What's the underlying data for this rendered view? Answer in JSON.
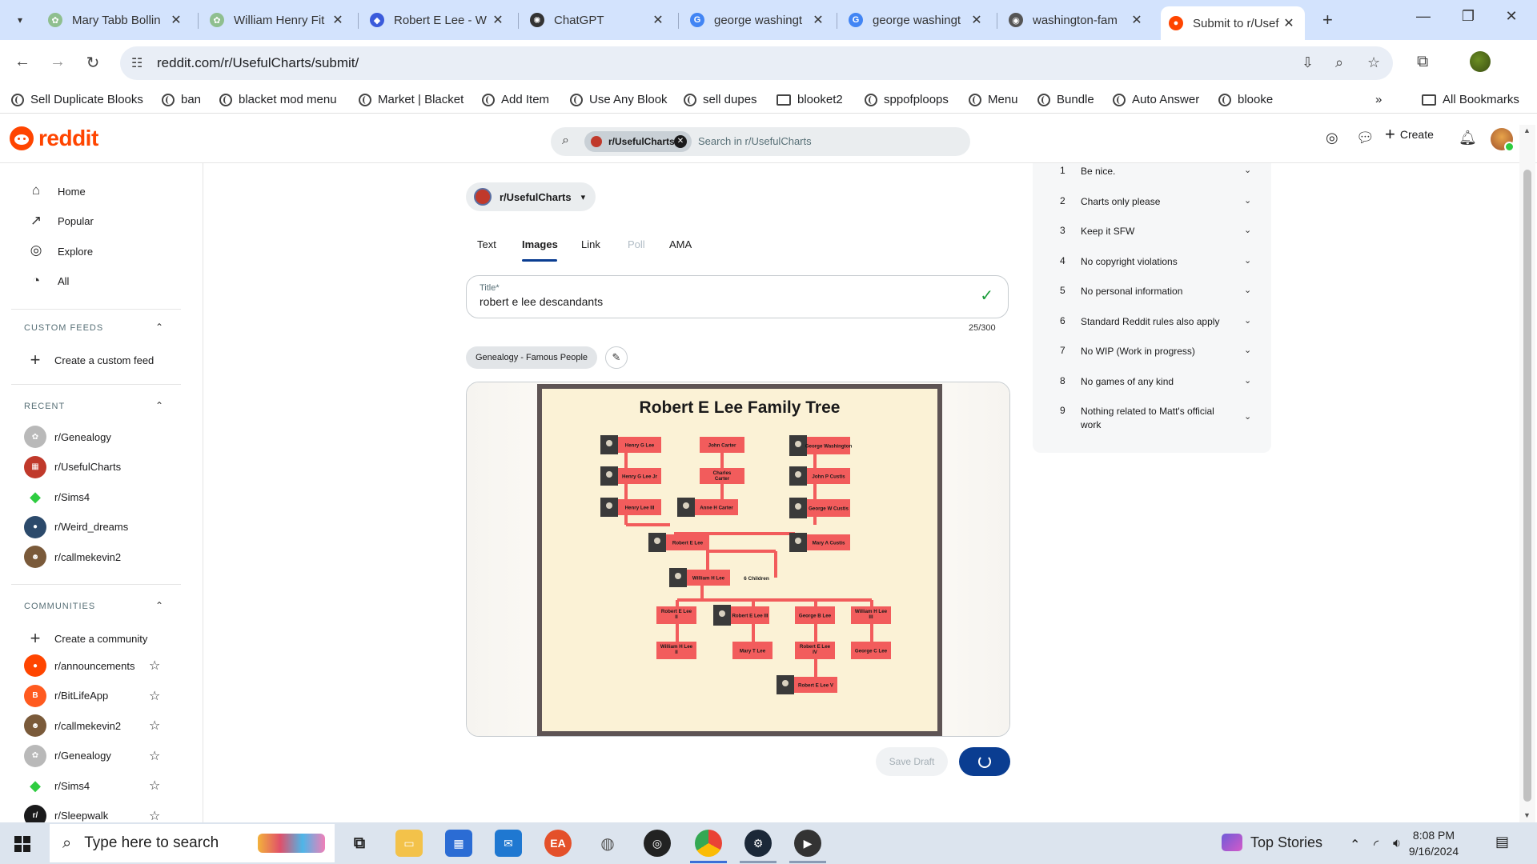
{
  "browser": {
    "tabs": [
      {
        "title": "Mary Tabb Bollin",
        "fav_color": "#8fbf8f",
        "fav": "✿"
      },
      {
        "title": "William Henry Fit",
        "fav_color": "#8fbf8f",
        "fav": "✿"
      },
      {
        "title": "Robert E Lee - W",
        "fav_color": "#3b5bdb",
        "fav": "◆"
      },
      {
        "title": "ChatGPT",
        "fav_color": "#333333",
        "fav": "✺"
      },
      {
        "title": "george washingt",
        "fav_color": "#4285f4",
        "fav": "G"
      },
      {
        "title": "george washingt",
        "fav_color": "#4285f4",
        "fav": "G"
      },
      {
        "title": "washington-fam",
        "fav_color": "#555555",
        "fav": "◉"
      },
      {
        "title": "Submit to r/Usef",
        "fav_color": "#ff4500",
        "fav": "●"
      }
    ],
    "url": "reddit.com/r/UsefulCharts/submit/",
    "bookmarks": [
      {
        "label": "Sell Duplicate Blooks",
        "type": "globe"
      },
      {
        "label": "ban",
        "type": "globe"
      },
      {
        "label": "blacket mod menu",
        "type": "globe"
      },
      {
        "label": "Market | Blacket",
        "type": "globe"
      },
      {
        "label": "Add Item",
        "type": "globe"
      },
      {
        "label": "Use Any Blook",
        "type": "globe"
      },
      {
        "label": "sell dupes",
        "type": "globe"
      },
      {
        "label": "blooket2",
        "type": "folder"
      },
      {
        "label": "sppofploops",
        "type": "globe"
      },
      {
        "label": "Menu",
        "type": "globe"
      },
      {
        "label": "Bundle",
        "type": "globe"
      },
      {
        "label": "Auto Answer",
        "type": "globe"
      },
      {
        "label": "blooke",
        "type": "globe"
      }
    ],
    "all_bookmarks": "All Bookmarks"
  },
  "header": {
    "logo": "reddit",
    "search_chip": "r/UsefulCharts",
    "search_placeholder": "Search in r/UsefulCharts",
    "create": "Create"
  },
  "sidebar": {
    "nav": [
      {
        "label": "Home",
        "icon": "⌂"
      },
      {
        "label": "Popular",
        "icon": "↗"
      },
      {
        "label": "Explore",
        "icon": "◎"
      },
      {
        "label": "All",
        "icon": "◔"
      }
    ],
    "custom_feeds_title": "CUSTOM FEEDS",
    "create_feed": "Create a custom feed",
    "recent_title": "RECENT",
    "recent": [
      {
        "label": "r/Genealogy",
        "color": "#b9b9b9",
        "glyph": "✿"
      },
      {
        "label": "r/UsefulCharts",
        "color": "#c0392b",
        "glyph": "▦"
      },
      {
        "label": "r/Sims4",
        "color": "#ffffff",
        "glyph": "◆"
      },
      {
        "label": "r/Weird_dreams",
        "color": "#2c4a6b",
        "glyph": "●"
      },
      {
        "label": "r/callmekevin2",
        "color": "#7a5a3a",
        "glyph": "☻"
      }
    ],
    "communities_title": "COMMUNITIES",
    "create_community": "Create a community",
    "communities": [
      {
        "label": "r/announcements",
        "color": "#ff4500",
        "glyph": "●"
      },
      {
        "label": "r/BitLifeApp",
        "color": "#ff5a1f",
        "glyph": "B"
      },
      {
        "label": "r/callmekevin2",
        "color": "#7a5a3a",
        "glyph": "☻"
      },
      {
        "label": "r/Genealogy",
        "color": "#b9b9b9",
        "glyph": "✿"
      },
      {
        "label": "r/Sims4",
        "color": "#ffffff",
        "glyph": "◆"
      },
      {
        "label": "r/Sleepwalk",
        "color": "#1a1a1b",
        "glyph": "r/"
      }
    ]
  },
  "post": {
    "subreddit": "r/UsefulCharts",
    "tabs": [
      "Text",
      "Images",
      "Link",
      "Poll",
      "AMA"
    ],
    "active_tab": "Images",
    "title_label": "Title*",
    "title_value": "robert e lee descandants",
    "counter": "25/300",
    "flair": "Genealogy - Famous People",
    "save_draft": "Save Draft"
  },
  "family_tree": {
    "heading": "Robert E Lee Family Tree",
    "boxes": {
      "henry_g_lee": "Henry G Lee",
      "henry_g_lee_jr": "Henry G Lee Jr",
      "henry_lee_iii": "Henry Lee III",
      "john_carter": "John Carter",
      "charles_carter": "Charles Carter",
      "anne_h_carter": "Anne H Carter",
      "george_washington": "George Washington",
      "john_p_custis": "John P Custis",
      "george_w_custis": "George W Custis",
      "robert_e_lee": "Robert E Lee",
      "mary_a_custis": "Mary A Custis",
      "william_h_lee": "William H Lee",
      "six_children": "6 Children",
      "robert_e_lee_ii": "Robert E Lee II",
      "robert_e_lee_iii": "Robert E Lee III",
      "george_b_lee": "George B Lee",
      "william_h_lee_iii": "William H Lee III",
      "william_h_lee_ii": "William H Lee II",
      "mary_t_lee": "Mary T Lee",
      "robert_e_lee_iv": "Robert E Lee IV",
      "george_c_lee": "George C Lee",
      "robert_e_lee_v": "Robert E Lee V"
    }
  },
  "rules": [
    {
      "num": "1",
      "text": "Be nice."
    },
    {
      "num": "2",
      "text": "Charts only please"
    },
    {
      "num": "3",
      "text": "Keep it SFW"
    },
    {
      "num": "4",
      "text": "No copyright violations"
    },
    {
      "num": "5",
      "text": "No personal information"
    },
    {
      "num": "6",
      "text": "Standard Reddit rules also apply"
    },
    {
      "num": "7",
      "text": "No WIP (Work in progress)"
    },
    {
      "num": "8",
      "text": "No games of any kind"
    },
    {
      "num": "9",
      "text": "Nothing related to Matt's official work"
    }
  ],
  "taskbar": {
    "search_placeholder": "Type here to search",
    "top_stories": "Top Stories",
    "time": "8:08 PM",
    "date": "9/16/2024"
  }
}
